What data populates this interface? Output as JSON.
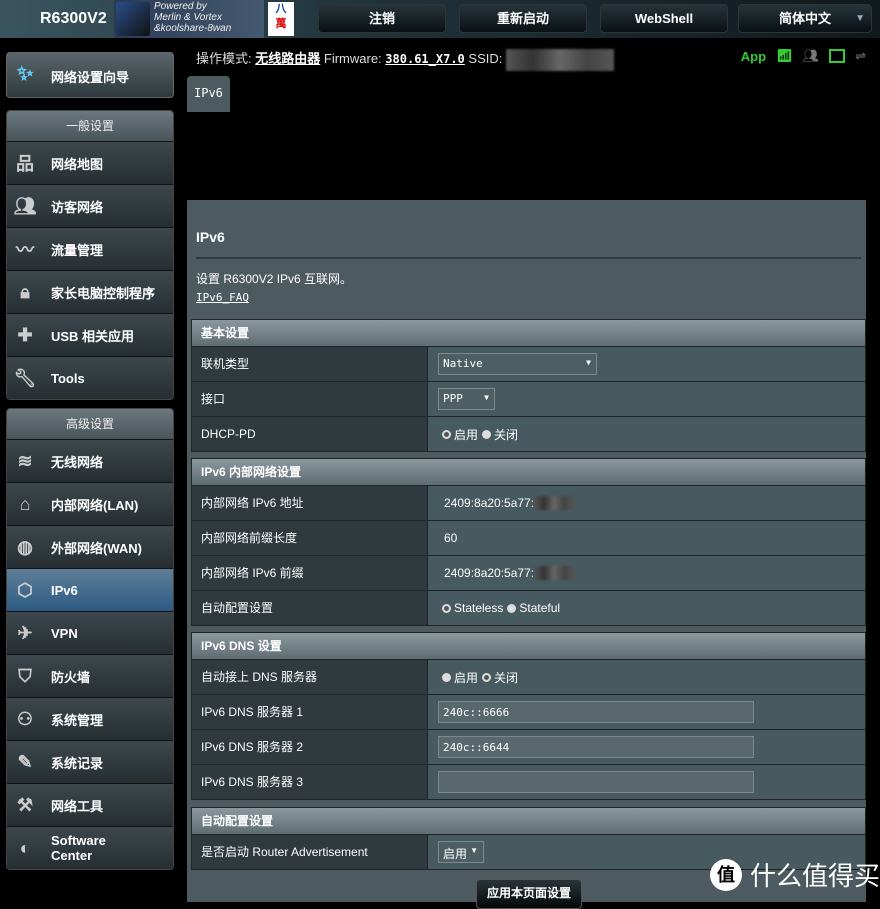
{
  "header": {
    "model": "R6300V2",
    "powered": [
      "Powered by",
      "Merlin & Vortex",
      "&koolshare-8wan"
    ],
    "badge": [
      "八",
      "萬"
    ],
    "buttons": [
      "注销",
      "重新启动",
      "WebShell",
      "简体中文"
    ]
  },
  "status": {
    "mode_label": "操作模式:",
    "mode": "无线路由器",
    "fw_label": "Firmware:",
    "fw": "380.61_X7.0",
    "ssid_label": "SSID:",
    "app": "App"
  },
  "tab": "IPv6",
  "sidebar": {
    "wizard": "网络设置向导",
    "general_title": "一般设置",
    "general": [
      {
        "label": "网络地图",
        "icon": "network-map-icon"
      },
      {
        "label": "访客网络",
        "icon": "guest-icon"
      },
      {
        "label": "流量管理",
        "icon": "traffic-icon"
      },
      {
        "label": "家长电脑控制程序",
        "icon": "lock-icon"
      },
      {
        "label": "USB 相关应用",
        "icon": "puzzle-icon"
      },
      {
        "label": "Tools",
        "icon": "wrench-icon"
      }
    ],
    "advanced_title": "高级设置",
    "advanced": [
      {
        "label": "无线网络",
        "icon": "wifi-icon"
      },
      {
        "label": "内部网络(LAN)",
        "icon": "home-icon"
      },
      {
        "label": "外部网络(WAN)",
        "icon": "globe-icon"
      },
      {
        "label": "IPv6",
        "icon": "ipv6-icon",
        "active": true
      },
      {
        "label": "VPN",
        "icon": "vpn-icon"
      },
      {
        "label": "防火墙",
        "icon": "shield-icon"
      },
      {
        "label": "系统管理",
        "icon": "admin-icon"
      },
      {
        "label": "系统记录",
        "icon": "log-icon"
      },
      {
        "label": "网络工具",
        "icon": "tools-icon"
      },
      {
        "label": "Software Center",
        "icon": "software-icon"
      }
    ]
  },
  "main": {
    "title": "IPv6",
    "desc": "设置 R6300V2 IPv6 互联网。",
    "faq": "IPv6_FAQ",
    "basic": {
      "title": "基本设置",
      "conn_label": "联机类型",
      "conn": "Native",
      "iface_label": "接口",
      "iface": "PPP",
      "dhcppd_label": "DHCP-PD",
      "on": "启用",
      "off": "关闭"
    },
    "lan": {
      "title": "IPv6 内部网络设置",
      "addr_label": "内部网络 IPv6 地址",
      "addr": "2409:8a20:5a77:",
      "prefixlen_label": "内部网络前缀长度",
      "prefixlen": "60",
      "prefix_label": "内部网络 IPv6 前缀",
      "prefix": "2409:8a20:5a77:",
      "auto_label": "自动配置设置",
      "stateless": "Stateless",
      "stateful": "Stateful"
    },
    "dns": {
      "title": "IPv6 DNS 设置",
      "auto_label": "自动接上 DNS 服务器",
      "on": "启用",
      "off": "关闭",
      "dns1_label": "IPv6 DNS 服务器 1",
      "dns1": "240c::6666",
      "dns2_label": "IPv6 DNS 服务器 2",
      "dns2": "240c::6644",
      "dns3_label": "IPv6 DNS 服务器 3",
      "dns3": ""
    },
    "ra": {
      "title": "自动配置设置",
      "label": "是否启动 Router Advertisement",
      "value": "启用"
    },
    "apply": "应用本页面设置"
  },
  "watermark": {
    "icon": "值",
    "text": "什么值得买"
  }
}
